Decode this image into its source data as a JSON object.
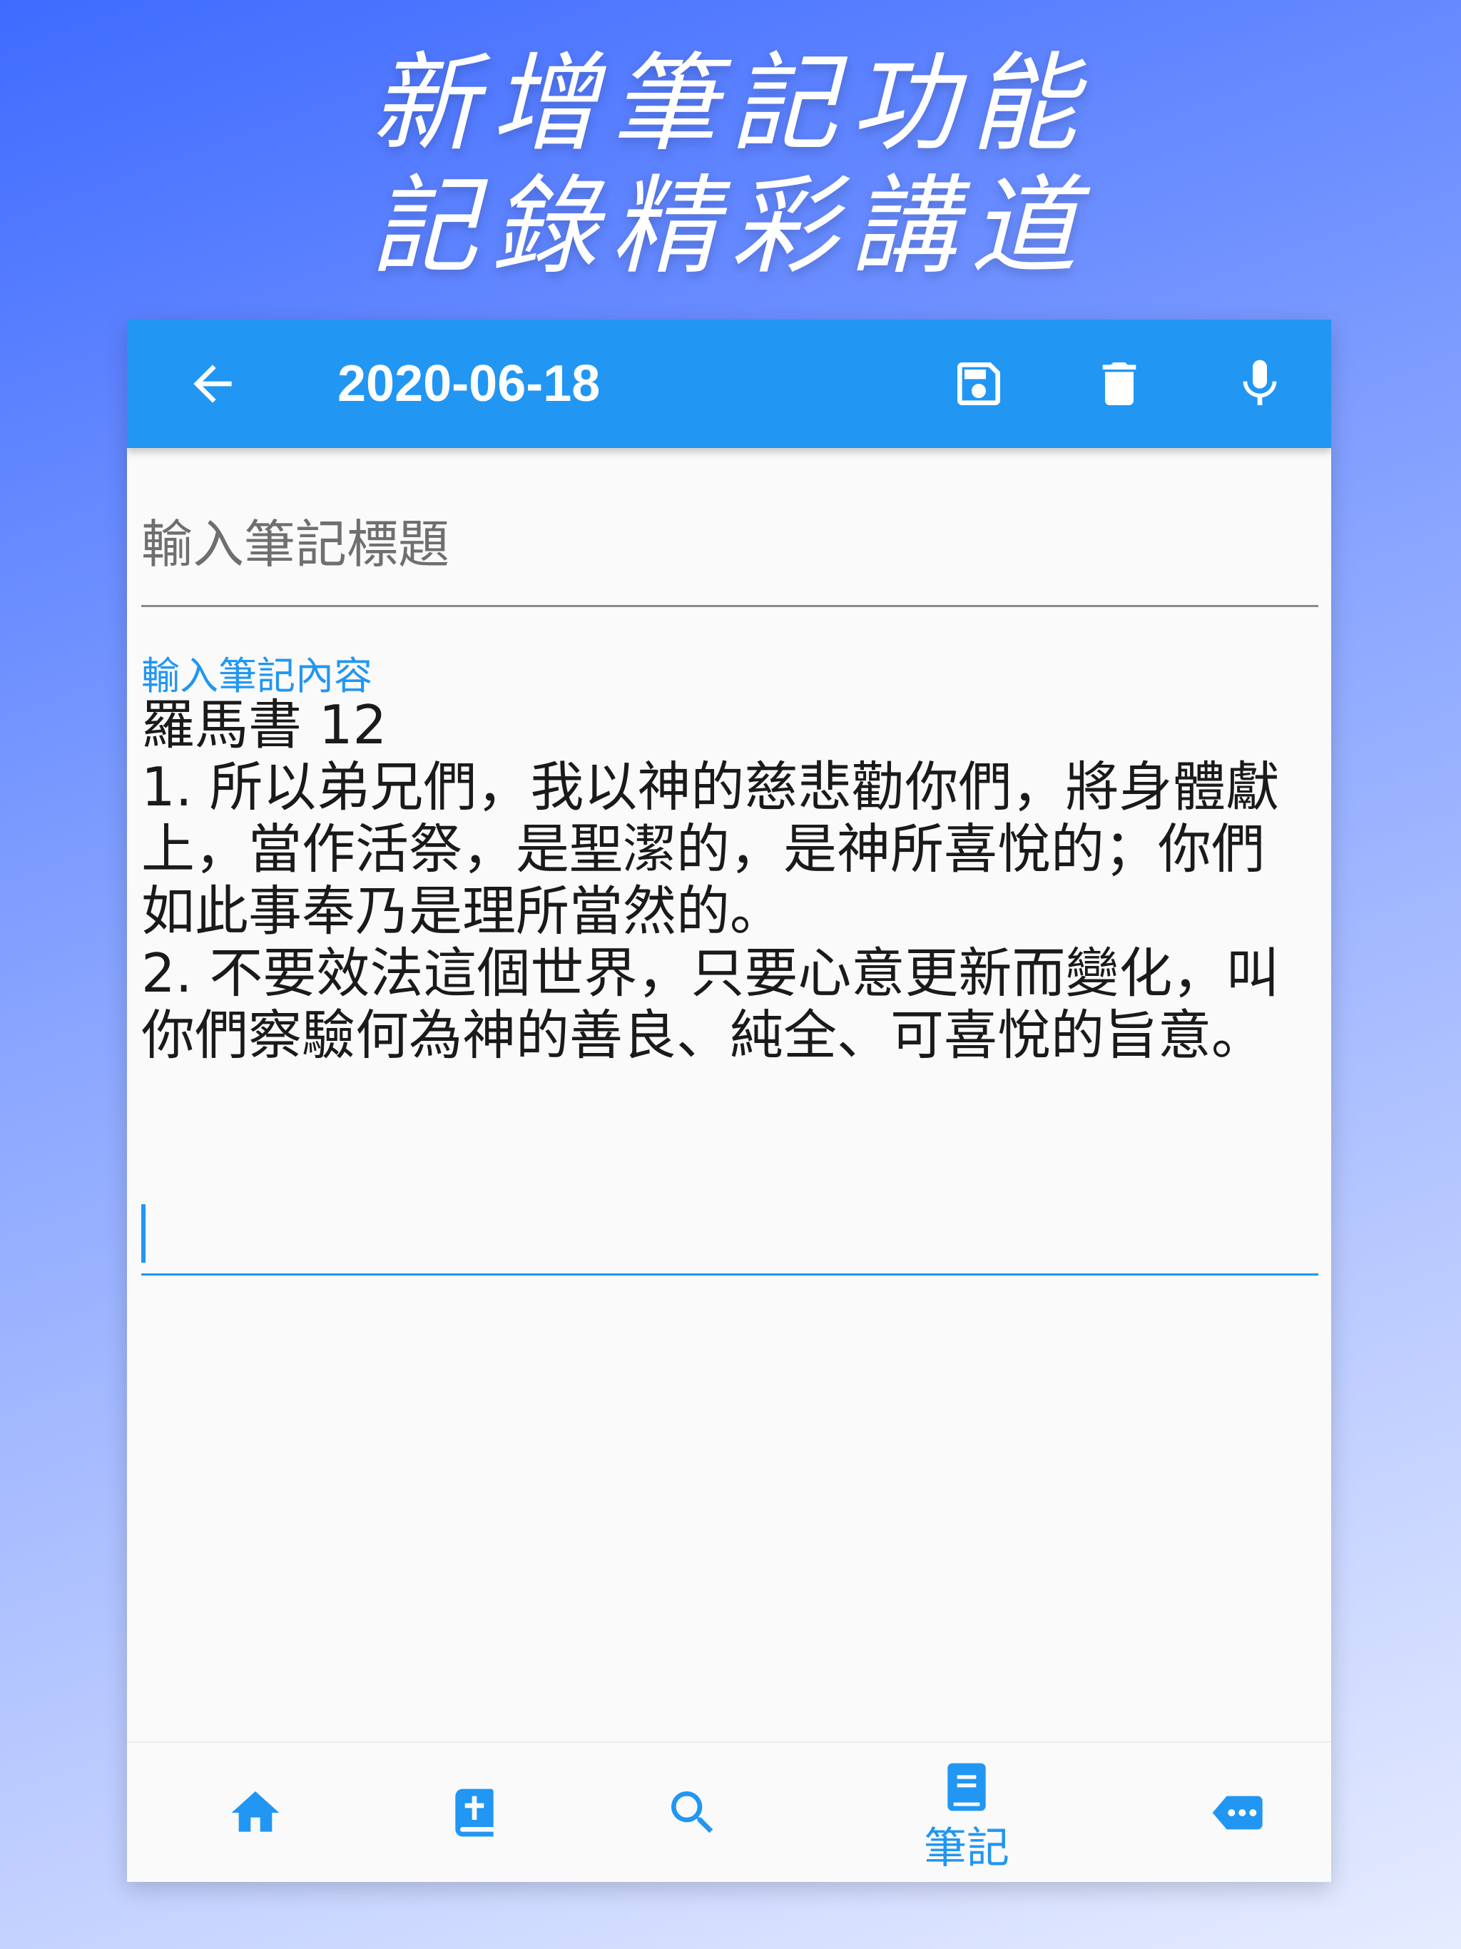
{
  "promo": {
    "line1": "新增筆記功能",
    "line2": "記錄精彩講道"
  },
  "appbar": {
    "title": "2020-06-18",
    "icons": [
      "back-arrow-icon",
      "save-icon",
      "trash-icon",
      "microphone-icon"
    ]
  },
  "note": {
    "title_placeholder": "輸入筆記標題",
    "content_label": "輸入筆記內容",
    "content": "羅馬書 12\n1. 所以弟兄們，我以神的慈悲勸你們，將身體獻上，當作活祭，是聖潔的，是神所喜悅的；你們如此事奉乃是理所當然的。\n2. 不要效法這個世界，只要心意更新而變化，叫你們察驗何為神的善良、純全、可喜悅的旨意。"
  },
  "bottomnav": {
    "items": [
      {
        "icon": "home-icon"
      },
      {
        "icon": "bible-icon"
      },
      {
        "icon": "search-icon"
      },
      {
        "icon": "notebook-icon",
        "label": "筆記",
        "active": true
      },
      {
        "icon": "more-icon"
      }
    ]
  },
  "colors": {
    "primary": "#2196f3",
    "background_top": "#3f6bff",
    "background_bottom": "#e6ecff"
  }
}
